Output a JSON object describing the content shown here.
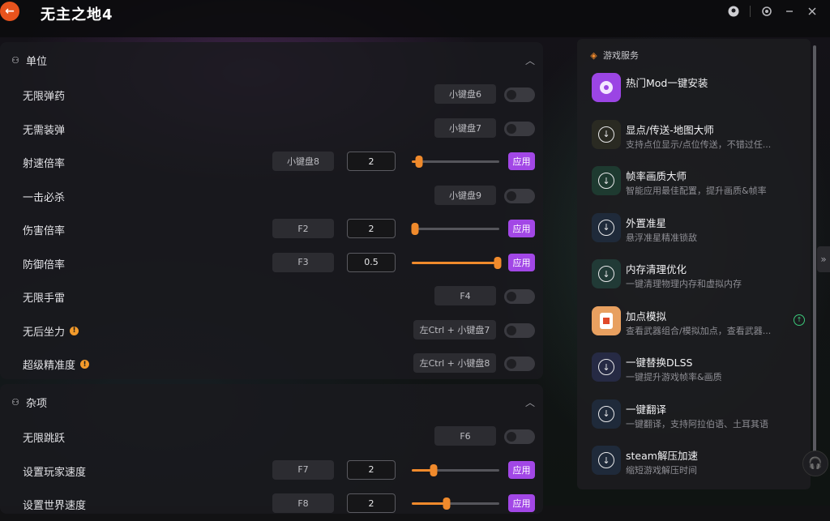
{
  "app": {
    "title": "无主之地4"
  },
  "topbar": {
    "icons": [
      "user-icon",
      "settings-icon",
      "minimize-icon",
      "close-icon"
    ]
  },
  "colors": {
    "accent_purple": "#a247e6",
    "accent_orange": "#f08a2c",
    "brand_orange": "#e8531d",
    "badge_green": "#3cc97a"
  },
  "unit_panel": {
    "title": "单位",
    "rows": [
      {
        "label": "无限弹药",
        "key": "小键盘6",
        "type": "toggle",
        "on": false
      },
      {
        "label": "无需装弹",
        "key": "小键盘7",
        "type": "toggle",
        "on": false
      },
      {
        "label": "射速倍率",
        "key": "小键盘8",
        "type": "slider",
        "value": "2",
        "level": 0.08,
        "apply": "应用"
      },
      {
        "label": "一击必杀",
        "key": "小键盘9",
        "type": "toggle",
        "on": false
      },
      {
        "label": "伤害倍率",
        "key": "F2",
        "type": "slider",
        "value": "2",
        "level": 0.04,
        "apply": "应用"
      },
      {
        "label": "防御倍率",
        "key": "F3",
        "type": "slider",
        "value": "0.5",
        "level": 1.0,
        "apply": "应用"
      },
      {
        "label": "无限手雷",
        "key": "F4",
        "type": "toggle",
        "on": false
      },
      {
        "label": "无后坐力",
        "key": "左Ctrl + 小键盘7",
        "type": "toggle",
        "on": false,
        "info": "!"
      },
      {
        "label": "超级精准度",
        "key": "左Ctrl + 小键盘8",
        "type": "toggle",
        "on": false,
        "info": "!"
      }
    ]
  },
  "misc_panel": {
    "title": "杂项",
    "rows": [
      {
        "label": "无限跳跃",
        "key": "F6",
        "type": "toggle",
        "on": false
      },
      {
        "label": "设置玩家速度",
        "key": "F7",
        "type": "slider",
        "value": "2",
        "level": 0.25,
        "apply": "应用"
      },
      {
        "label": "设置世界速度",
        "key": "F8",
        "type": "slider",
        "value": "2",
        "level": 0.4,
        "apply": "应用"
      }
    ]
  },
  "services": {
    "title": "游戏服务",
    "items": [
      {
        "title": "热门Mod一键安装",
        "desc": "",
        "icon": "mod-icon",
        "color": "#9b45e4"
      },
      {
        "title": "显点/传送-地图大师",
        "desc": "支持点位显示/点位传送，不错过任...",
        "icon": "download-icon",
        "color": "#2a2a22"
      },
      {
        "title": "帧率画质大师",
        "desc": "智能应用最佳配置，提升画质&帧率",
        "icon": "download-icon",
        "color": "#1e3a30"
      },
      {
        "title": "外置准星",
        "desc": "悬浮准星精准锁敌",
        "icon": "download-icon",
        "color": "#1f2a3a"
      },
      {
        "title": "内存清理优化",
        "desc": "一键清理物理内存和虚拟内存",
        "icon": "download-icon",
        "color": "#213a36"
      },
      {
        "title": "加点模拟",
        "desc": "查看武器组合/模拟加点，查看武器...",
        "icon": "card-icon",
        "color": "#e8a060",
        "badge": "↑"
      },
      {
        "title": "一键替换DLSS",
        "desc": "一键提升游戏帧率&画质",
        "icon": "download-icon",
        "color": "#262a44"
      },
      {
        "title": "一键翻译",
        "desc": "一键翻译，支持阿拉伯语、土耳其语",
        "icon": "download-icon",
        "color": "#1f2a3a"
      },
      {
        "title": "steam解压加速",
        "desc": "缩短游戏解压时间",
        "icon": "download-icon",
        "color": "#1f2a3a"
      }
    ]
  }
}
